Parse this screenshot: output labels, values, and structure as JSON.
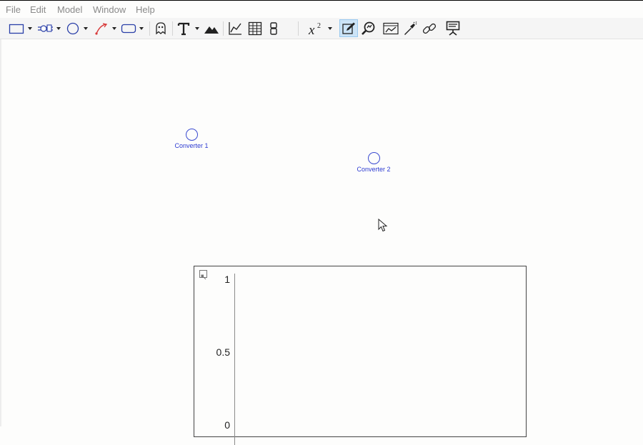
{
  "menu": {
    "file": "File",
    "edit": "Edit",
    "model": "Model",
    "window": "Window",
    "help": "Help"
  },
  "toolbar": {
    "icons": [
      "stock-icon",
      "flow-icon",
      "converter-icon",
      "connector-icon",
      "module-icon",
      "ghost-icon",
      "text-icon",
      "image-icon",
      "graph-icon",
      "table-icon",
      "numeric-display-icon",
      "equation-icon",
      "edit-mode-icon",
      "zoom-icon",
      "comparative-graph-icon",
      "flashlight-icon",
      "link-icon",
      "presentation-icon"
    ],
    "equation_label": "x"
  },
  "canvas": {
    "converters": [
      {
        "label": "Converter 1"
      },
      {
        "label": "Converter 2"
      }
    ]
  },
  "graph": {
    "y_ticks": [
      "1",
      "0.5",
      "0"
    ]
  },
  "colors": {
    "converter_blue": "#3a4ad0",
    "menu_text": "#8a8a8a",
    "active_tool_bg": "#cce4f7"
  }
}
